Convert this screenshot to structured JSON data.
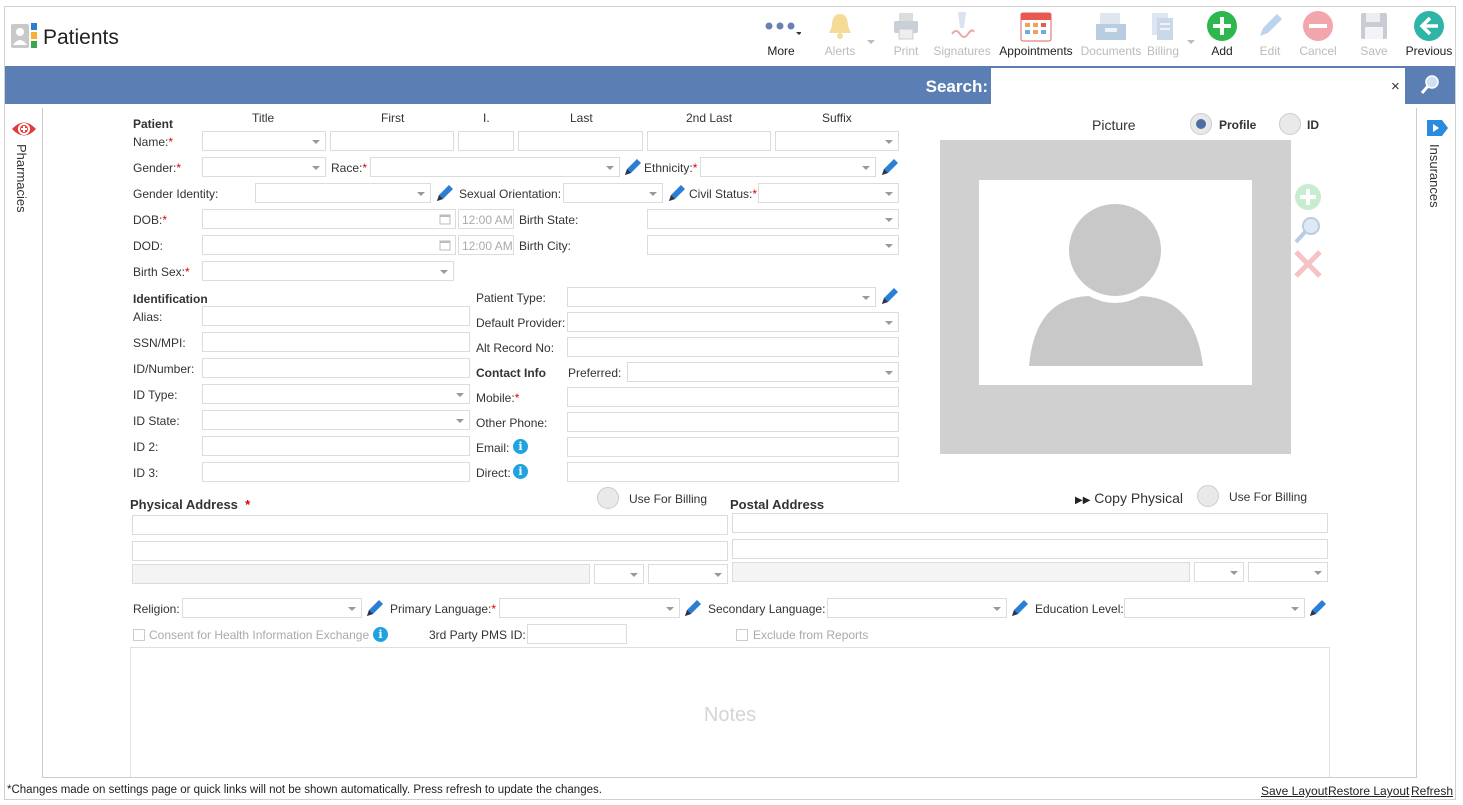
{
  "header": {
    "title": "Patients"
  },
  "toolbar": {
    "more": "More",
    "alerts": "Alerts",
    "print": "Print",
    "signatures": "Signatures",
    "appointments": "Appointments",
    "documents": "Documents",
    "billing": "Billing",
    "add": "Add",
    "edit": "Edit",
    "cancel": "Cancel",
    "save": "Save",
    "previous": "Previous"
  },
  "search": {
    "label": "Search:",
    "value": "",
    "clear": "×"
  },
  "sidebar": {
    "left": "Pharmacies",
    "right": "Insurances"
  },
  "name_headers": {
    "title": "Title",
    "first": "First",
    "initial": "I.",
    "last": "Last",
    "second_last": "2nd Last",
    "suffix": "Suffix"
  },
  "patient": {
    "section": "Patient",
    "name": "Name:",
    "gender": "Gender:",
    "race": "Race:",
    "ethnicity": "Ethnicity:",
    "gender_identity": "Gender Identity:",
    "sexual_orientation": "Sexual Orientation:",
    "civil_status": "Civil Status:",
    "dob": "DOB:",
    "dod": "DOD:",
    "time_placeholder": "12:00 AM",
    "birth_state": "Birth State:",
    "birth_city": "Birth City:",
    "birth_sex": "Birth Sex:"
  },
  "identification": {
    "section": "Identification",
    "alias": "Alias:",
    "ssn": "SSN/MPI:",
    "id_number": "ID/Number:",
    "id_type": "ID Type:",
    "id_state": "ID State:",
    "id2": "ID 2:",
    "id3": "ID 3:"
  },
  "patient_info": {
    "patient_type": "Patient Type:",
    "default_provider": "Default Provider:",
    "alt_record": "Alt Record No:"
  },
  "contact": {
    "section": "Contact Info",
    "preferred": "Preferred:",
    "mobile": "Mobile:",
    "other_phone": "Other Phone:",
    "email": "Email:",
    "direct": "Direct:"
  },
  "picture": {
    "title": "Picture",
    "profile": "Profile",
    "id": "ID"
  },
  "physical": {
    "title": "Physical Address",
    "use_for_billing": "Use For Billing"
  },
  "postal": {
    "title": "Postal Address",
    "copy": "Copy Physical",
    "use_for_billing": "Use For Billing"
  },
  "misc": {
    "religion": "Religion:",
    "primary_language": "Primary Language:",
    "secondary_language": "Secondary Language:",
    "education_level": "Education Level:",
    "consent": "Consent for Health Information Exchange",
    "third_party": "3rd Party PMS ID:",
    "exclude": "Exclude from Reports"
  },
  "notes": {
    "placeholder": "Notes"
  },
  "footer": {
    "notice": "*Changes made on settings page or quick links will not be shown automatically. Press refresh to update the changes.",
    "save_layout": "Save Layout",
    "restore_layout": "Restore Layout",
    "refresh": "Refresh"
  },
  "colors": {
    "accent": "#5b7fb5",
    "required": "#dd0000",
    "info": "#1fa3e0",
    "add_green": "#2db84d",
    "cancel_red": "#e8505b"
  }
}
